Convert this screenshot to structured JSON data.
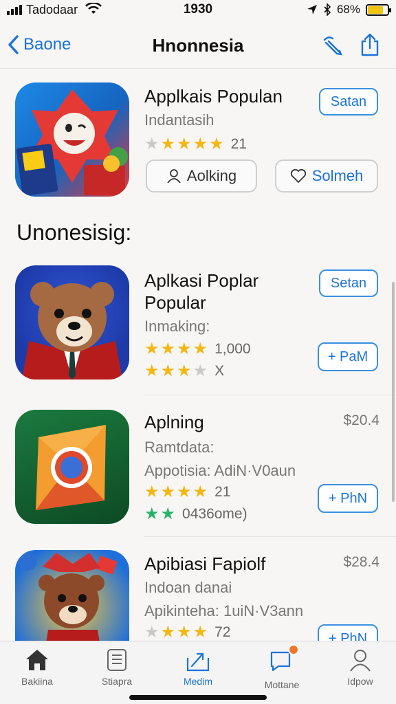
{
  "status": {
    "carrier": "Tadodaar",
    "time": "1930",
    "battery_text": "68%",
    "battery_level": 0.8
  },
  "nav": {
    "back_label": "Baone",
    "title": "Hnonnesia"
  },
  "featured": {
    "name": "Applkais Populan",
    "subtitle": "Indantasih",
    "rating_count": "21",
    "action_label": "Satan",
    "ranking_label": "Aolking",
    "wishlist_label": "Solmeh"
  },
  "section_title": "Unonesisig:",
  "apps": [
    {
      "name_line1": "Aplkasi Poplar",
      "name_line2": "Popular",
      "subtitle": "Inmaking:",
      "rating_count": "1,000",
      "secondary_rating": "X",
      "top_button": "Setan",
      "get_button": "+ PaM"
    },
    {
      "name_line1": "Aplning",
      "subtitle": "Ramtdata:",
      "category": "Appotisia:  AdiN·V0aun",
      "rating_count": "21",
      "secondary_rating": "0436ome)",
      "price": "$20.4",
      "get_button": "+ PhN"
    },
    {
      "name_line1": "Apibiasi Fapiolf",
      "subtitle": "Indoan danai",
      "category": "Apikinteha:  1uiN·V3ann",
      "rating_count": "72",
      "price": "$28.4",
      "get_button": "+ PhN"
    }
  ],
  "tabs": [
    {
      "label": "Bakiina"
    },
    {
      "label": "Stiapra"
    },
    {
      "label": "Medim"
    },
    {
      "label": "Mottane"
    },
    {
      "label": "Idpow"
    }
  ],
  "colors": {
    "accent": "#1a73d9",
    "star": "#f3b712",
    "badge": "#f0762b"
  }
}
